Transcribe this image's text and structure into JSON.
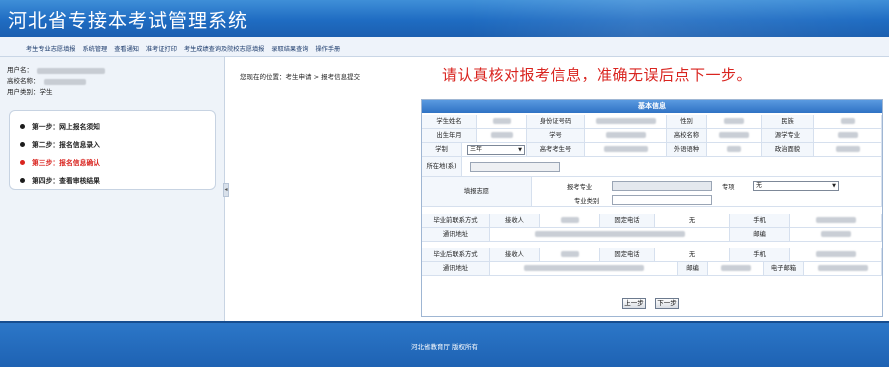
{
  "header": {
    "title": "河北省专接本考试管理系统"
  },
  "nav": {
    "items": [
      "考生专业志愿填报",
      "系统管理",
      "查看通知",
      "准考证打印",
      "考生成绩查询及院校志愿填报",
      "录取结果查询",
      "操作手册"
    ]
  },
  "user": {
    "user_label": "用户名：",
    "school_label": "高校名称：",
    "type_label": "用户类别：",
    "type_value": "学生"
  },
  "steps": [
    {
      "label": "第一步：网上报名须知"
    },
    {
      "label": "第二步：报名信息录入"
    },
    {
      "label": "第三步：报名信息确认"
    },
    {
      "label": "第四步：查看审核结果"
    }
  ],
  "breadcrumb": "您现在的位置：考生申请 > 报考信息提交",
  "notice": "请认真核对报考信息，准确无误后点下一步。",
  "form": {
    "title": "基本信息",
    "labels": {
      "name": "学生姓名",
      "id_card": "身份证号码",
      "gender": "性别",
      "ethnicity": "民族",
      "birth": "出生年月",
      "student_no": "学号",
      "school_name": "高校名称",
      "source_major": "源学专业",
      "schooling": "学制",
      "exam_no": "高考考生号",
      "foreign_lang": "外语语种",
      "political": "政治面貌",
      "location": "所在地(系)",
      "volunteer": "填报志愿",
      "apply_major": "报考专业",
      "major_type": "专业类别",
      "specialty": "专项"
    },
    "schooling_value": "三年",
    "specialty_value": "无",
    "contact_grad": {
      "title": "毕业前联系方式",
      "receiver": "接收人",
      "phone_label": "固定电话",
      "phone_value": "无",
      "mobile": "手机",
      "address": "通讯地址",
      "postcode": "邮编"
    },
    "contact_after": {
      "title": "毕业后联系方式",
      "receiver": "接收人",
      "phone_label": "固定电话",
      "phone_value": "无",
      "mobile": "手机",
      "address": "通讯地址",
      "postcode": "邮编",
      "email": "电子邮箱"
    }
  },
  "buttons": {
    "prev": "上一步",
    "next": "下一步"
  },
  "footer": {
    "text": "河北省教育厅  版权所有"
  },
  "colors": {
    "header_blue": "#1f6cc2",
    "notice_red": "#d9241f",
    "active_step": "#d9241f"
  }
}
